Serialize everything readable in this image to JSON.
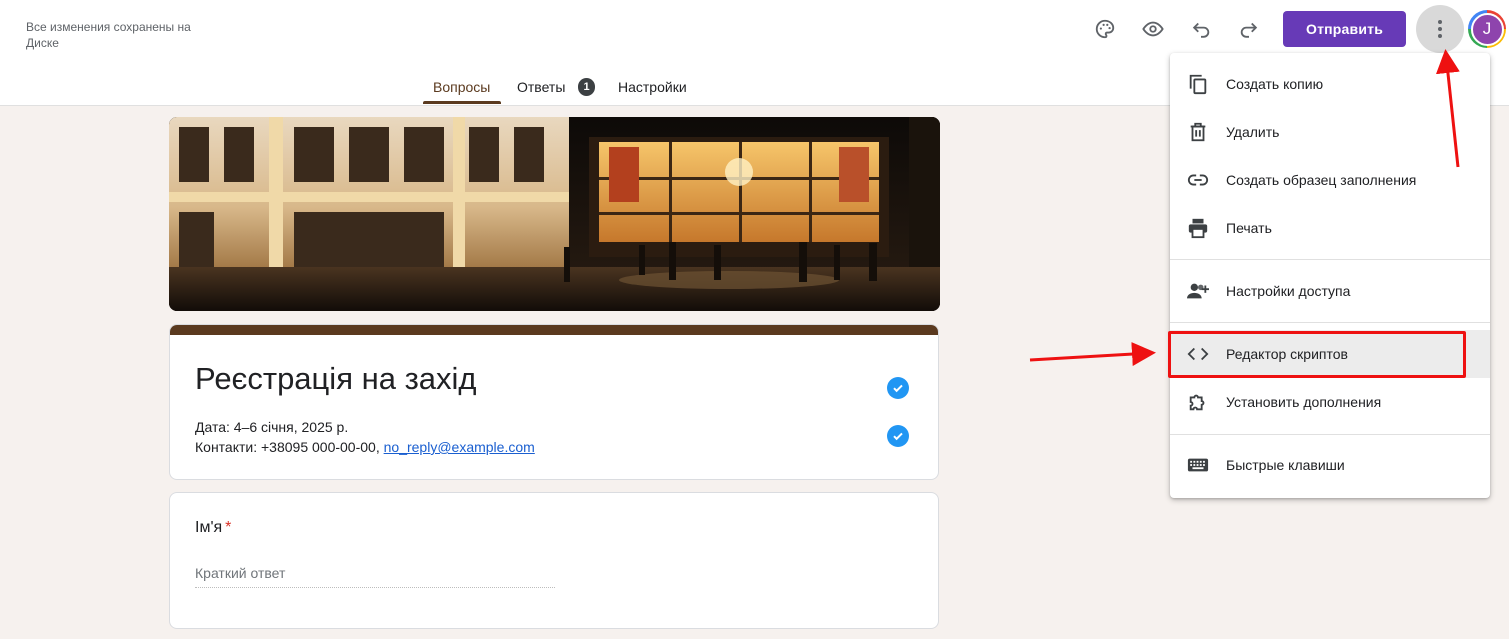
{
  "header": {
    "save_status": "Все изменения сохранены на Диске",
    "send_label": "Отправить",
    "avatar_letter": "J",
    "icons": [
      "palette-icon",
      "eye-icon",
      "undo-icon",
      "redo-icon",
      "more-vert-icon"
    ]
  },
  "tabs": [
    {
      "label": "Вопросы",
      "active": true
    },
    {
      "label": "Ответы",
      "badge": "1"
    },
    {
      "label": "Настройки"
    }
  ],
  "form": {
    "title": "Реєстрація на захід",
    "desc_line1": "Дата: 4–6 січня, 2025 р.",
    "desc_line2_prefix": "Контакти: +38095 000-00-00,",
    "desc_email": "no_reply@example.com"
  },
  "question": {
    "title": "Ім'я",
    "required_mark": "*",
    "placeholder": "Краткий ответ"
  },
  "menu": {
    "items": [
      {
        "label": "Создать копию",
        "icon": "copy-icon"
      },
      {
        "label": "Удалить",
        "icon": "trash-icon"
      },
      {
        "label": "Создать образец заполнения",
        "icon": "link-icon"
      },
      {
        "label": "Печать",
        "icon": "print-icon"
      },
      {
        "label": "Настройки доступа",
        "icon": "people-add-icon"
      },
      {
        "label": "Редактор скриптов",
        "icon": "code-icon",
        "highlighted": true
      },
      {
        "label": "Установить дополнения",
        "icon": "puzzle-icon"
      },
      {
        "label": "Быстрые клавиши",
        "icon": "keyboard-icon"
      }
    ]
  },
  "colors": {
    "accent": "#673ab7",
    "theme": "#5b3a1f",
    "annotation": "#ee1111",
    "check": "#2196f3"
  }
}
